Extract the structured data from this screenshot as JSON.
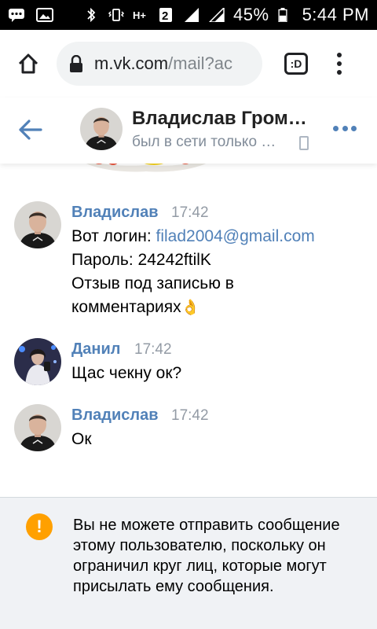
{
  "status_bar": {
    "icons": [
      "chat-icon",
      "image-icon",
      "bluetooth-icon",
      "vibrate-icon",
      "h-plus-icon",
      "sim-2-icon",
      "signal-icon",
      "signal-icon",
      "battery-icon"
    ],
    "battery": "45%",
    "time": "5:44 PM"
  },
  "browser": {
    "url_host": "m.vk.com",
    "url_path": "/mail?ac",
    "tabs_label": ":D"
  },
  "chat_header": {
    "name": "Владислав Гром…",
    "status": "был в сети только …"
  },
  "messages": [
    {
      "author": "Владислав",
      "time": "17:42",
      "lines": [
        {
          "text": "Вот логин: ",
          "link": "filad2004@gmail.com"
        },
        {
          "text": "Пароль: 24242ftilK"
        },
        {
          "text": "Отзыв под записью в"
        },
        {
          "text": "комментариях",
          "emoji": "👌"
        }
      ]
    },
    {
      "author": "Данил",
      "time": "17:42",
      "lines": [
        {
          "text": "Щас чекну ок?"
        }
      ]
    },
    {
      "author": "Владислав",
      "time": "17:42",
      "lines": [
        {
          "text": "Ок"
        }
      ]
    }
  ],
  "notice": {
    "text": "Вы не можете отправить сообщение этому пользователю, поскольку он ограничил круг лиц, которые могут присылать ему сообщения.",
    "icon": "!"
  },
  "colors": {
    "accent": "#5181b8",
    "warning": "#ffa000",
    "muted": "#818c99"
  }
}
